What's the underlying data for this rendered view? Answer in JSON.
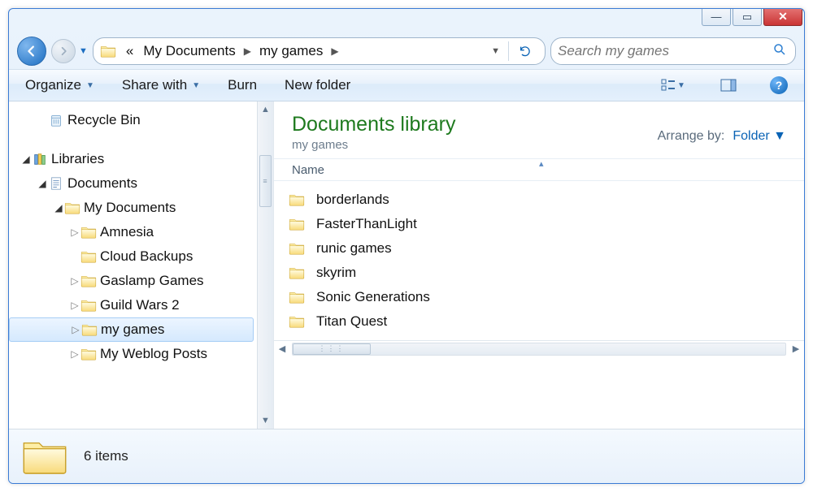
{
  "breadcrumb": {
    "level1": "My Documents",
    "level2": "my games"
  },
  "search": {
    "placeholder": "Search my games"
  },
  "toolbar": {
    "organize": "Organize",
    "share": "Share with",
    "burn": "Burn",
    "new_folder": "New folder"
  },
  "tree": {
    "recycle": "Recycle Bin",
    "libraries": "Libraries",
    "documents": "Documents",
    "my_documents": "My Documents",
    "items": [
      "Amnesia",
      "Cloud Backups",
      "Gaslamp Games",
      "Guild Wars 2",
      "my games",
      "My Weblog Posts"
    ],
    "selected_index": 4
  },
  "library": {
    "title": "Documents library",
    "subtitle": "my games",
    "arrange_label": "Arrange by:",
    "arrange_value": "Folder",
    "column": "Name"
  },
  "files": [
    "borderlands",
    "FasterThanLight",
    "runic games",
    "skyrim",
    "Sonic Generations",
    "Titan Quest"
  ],
  "status": {
    "count": "6 items"
  }
}
